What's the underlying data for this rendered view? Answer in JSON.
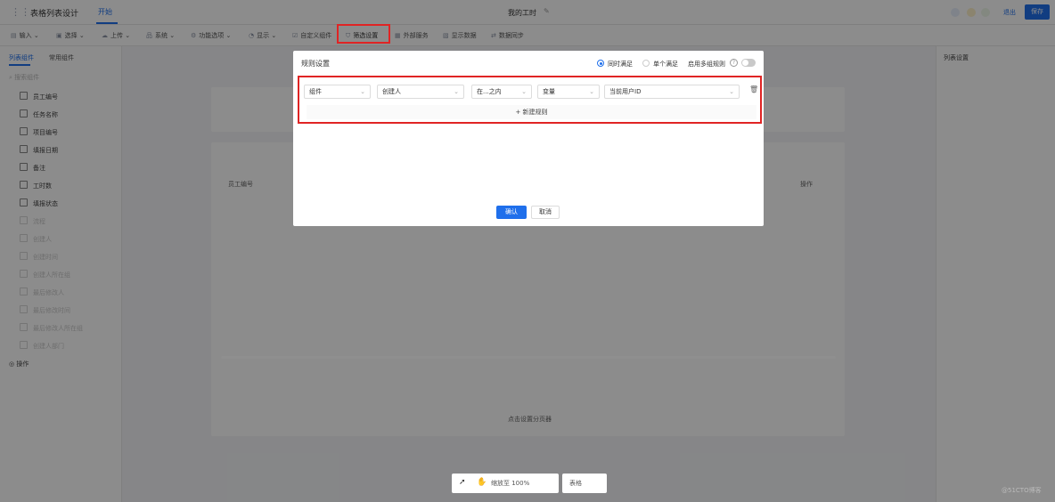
{
  "header": {
    "app_title": "表格列表设计",
    "tab_start": "开始",
    "window_title": "我的工时",
    "exit_label": "退出",
    "save_label": "保存"
  },
  "toolbar": {
    "items": [
      "输入",
      "选择",
      "上传",
      "系统",
      "功能选项",
      "显示",
      "自定义组件",
      "筛选设置",
      "外部服务",
      "显示数据",
      "数据同步"
    ]
  },
  "left_panel": {
    "tab_active": "列表组件",
    "tab_other": "常用组件",
    "search_placeholder": "搜索组件",
    "components": [
      "员工编号",
      "任务名称",
      "项目编号",
      "填报日期",
      "备注",
      "工时数",
      "填报状态"
    ],
    "disabled_components": [
      "流程",
      "创建人",
      "创建时间",
      "创建人所在组",
      "最后修改人",
      "最后修改时间",
      "最后修改人所在组",
      "创建人部门"
    ],
    "group_label": "操作"
  },
  "right_panel": {
    "title": "列表设置"
  },
  "canvas": {
    "column_1": "员工编号",
    "column_ops": "操作",
    "footer_hint": "点击设置分页器",
    "zoom": "缩放至 100%",
    "mode": "表格"
  },
  "modal": {
    "title": "规则设置",
    "radio_all": "同时满足",
    "radio_any": "单个满足",
    "multi_group": "启用多组规则",
    "rule": {
      "field_type": "组件",
      "field": "创建人",
      "operator": "在...之内",
      "value_type": "变量",
      "value": "当前用户ID"
    },
    "add_rule": "新建规则",
    "confirm": "确认",
    "cancel": "取消"
  },
  "watermark": "@51CTO博客",
  "colors": {
    "accent": "#1f6feb",
    "highlight": "#e02424"
  }
}
